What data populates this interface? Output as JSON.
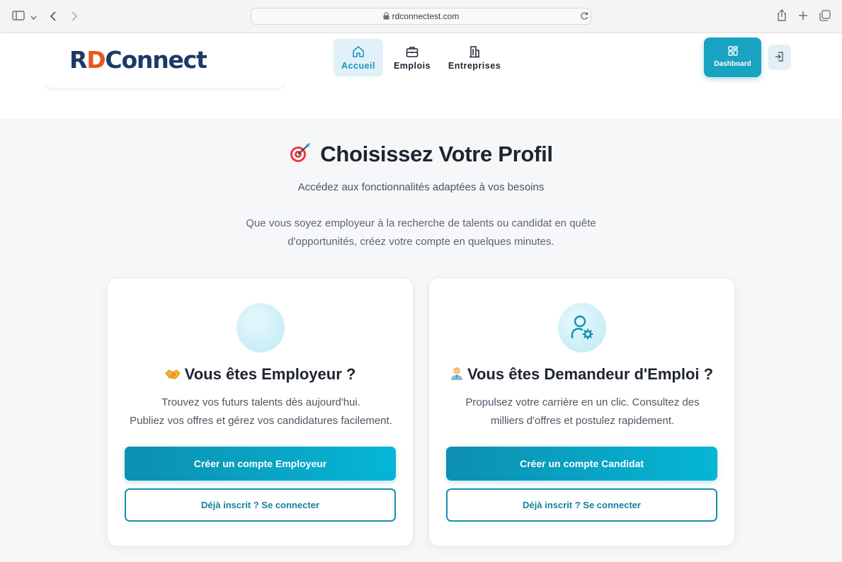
{
  "browser": {
    "url": "rdconnectest.com"
  },
  "header": {
    "logo": {
      "r": "R",
      "d": "D",
      "rest": "Connect"
    },
    "nav": [
      {
        "label": "Accueil",
        "icon": "home-icon",
        "active": true
      },
      {
        "label": "Emplois",
        "icon": "briefcase-icon",
        "active": false
      },
      {
        "label": "Entreprises",
        "icon": "building-icon",
        "active": false
      }
    ],
    "dashboard_label": "Dashboard"
  },
  "section": {
    "title": "Choisissez Votre Profil",
    "subtitle": "Accédez aux fonctionnalités adaptées à vos besoins",
    "description_line1": "Que vous soyez employeur à la recherche de talents ou candidat en quête",
    "description_line2": "d'opportunités, créez votre compte en quelques minutes."
  },
  "cards": [
    {
      "title": "Vous êtes Employeur ?",
      "emoji_icon": "handshake-icon",
      "text_line1": "Trouvez vos futurs talents dès aujourd'hui.",
      "text_line2": "Publiez vos offres et gérez vos candidatures facilement.",
      "primary_label": "Créer un compte Employeur",
      "secondary_label": "Déjà inscrit ? Se connecter"
    },
    {
      "title": "Vous êtes Demandeur d'Emploi ?",
      "emoji_icon": "office-worker-icon",
      "text_line1": "Propulsez votre carrière en un clic. Consultez des",
      "text_line2": "milliers d'offres et postulez rapidement.",
      "primary_label": "Créer un compte Candidat",
      "secondary_label": "Déjà inscrit ? Se connecter"
    }
  ],
  "colors": {
    "brand_navy": "#1c3a66",
    "brand_orange": "#e4581e",
    "accent_teal": "#1aa3c0"
  }
}
